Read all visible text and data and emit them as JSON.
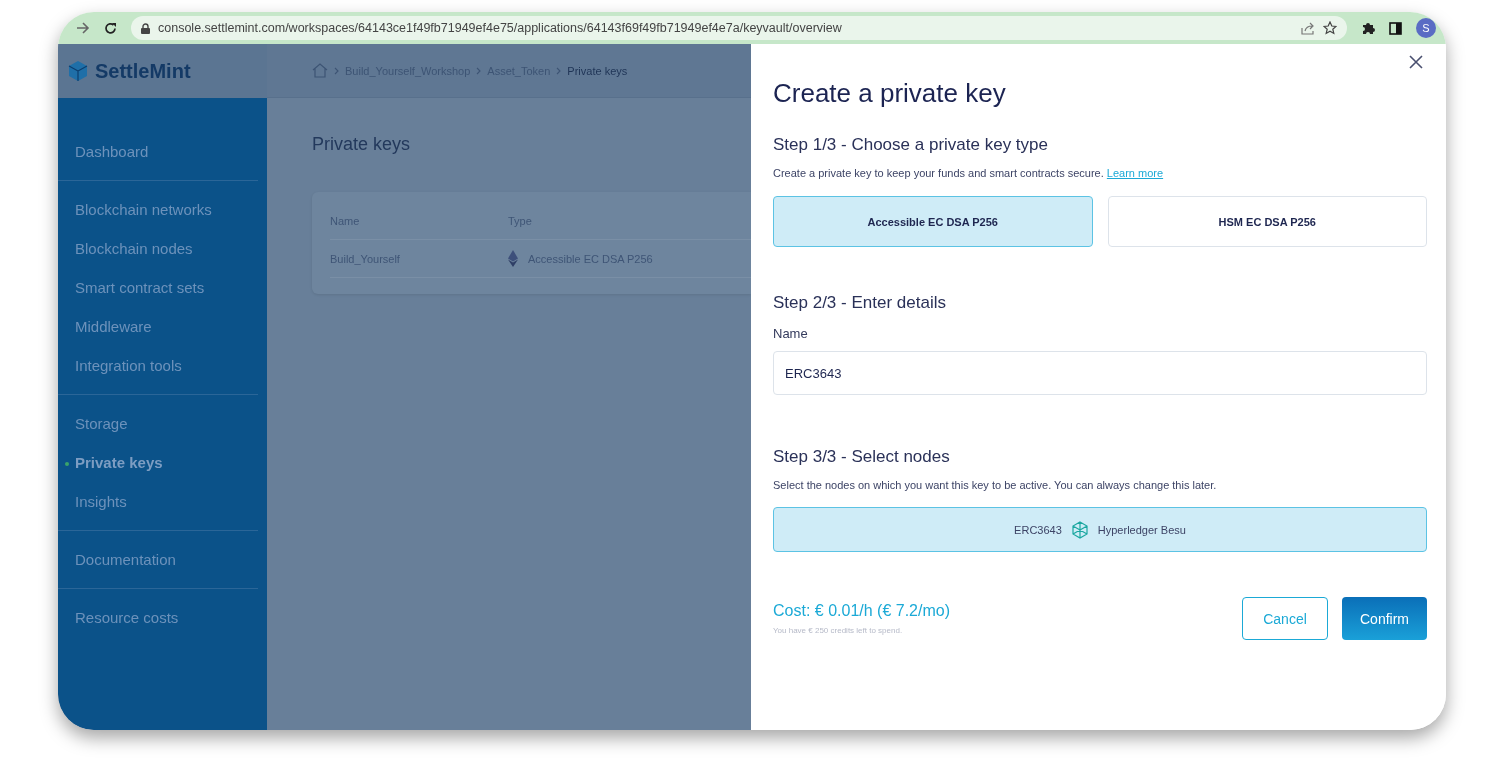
{
  "browser": {
    "url": "console.settlemint.com/workspaces/64143ce1f49fb71949ef4e75/applications/64143f69f49fb71949ef4e7a/keyvault/overview",
    "avatar": "S"
  },
  "app": {
    "logo": "SettleMint",
    "breadcrumbs": [
      "Build_Yourself_Workshop",
      "Asset_Token",
      "Private keys"
    ],
    "sidebar": {
      "groups": [
        {
          "items": [
            {
              "label": "Dashboard",
              "selected": false
            }
          ]
        },
        {
          "items": [
            {
              "label": "Blockchain networks",
              "selected": false
            },
            {
              "label": "Blockchain nodes",
              "selected": false
            },
            {
              "label": "Smart contract sets",
              "selected": false
            },
            {
              "label": "Middleware",
              "selected": false
            },
            {
              "label": "Integration tools",
              "selected": false
            }
          ]
        },
        {
          "items": [
            {
              "label": "Storage",
              "selected": false
            },
            {
              "label": "Private keys",
              "selected": true
            },
            {
              "label": "Insights",
              "selected": false
            }
          ]
        },
        {
          "items": [
            {
              "label": "Documentation",
              "selected": false
            }
          ]
        },
        {
          "items": [
            {
              "label": "Resource costs",
              "selected": false
            }
          ]
        }
      ]
    },
    "page_title": "Private keys",
    "table": {
      "columns": [
        "Name",
        "Type"
      ],
      "rows": [
        {
          "name": "Build_Yourself",
          "type": "Accessible EC DSA P256"
        }
      ]
    }
  },
  "modal": {
    "title": "Create a private key",
    "step1": {
      "heading": "Step 1/3 - Choose a private key type",
      "description": "Create a private key to keep your funds and smart contracts secure.",
      "link": "Learn more",
      "options": [
        {
          "label": "Accessible EC DSA P256",
          "selected": true
        },
        {
          "label": "HSM EC DSA P256",
          "selected": false
        }
      ]
    },
    "step2": {
      "heading": "Step 2/3 - Enter details",
      "field_label": "Name",
      "value": "ERC3643"
    },
    "step3": {
      "heading": "Step 3/3 - Select nodes",
      "description": "Select the nodes on which you want this key to be active. You can always change this later.",
      "nodes": [
        {
          "name": "ERC3643",
          "network": "Hyperledger Besu",
          "selected": true
        }
      ]
    },
    "cost": "Cost: € 0.01/h (€ 7.2/mo)",
    "credits": "You have € 250 credits left to spend.",
    "buttons": {
      "cancel": "Cancel",
      "confirm": "Confirm"
    }
  }
}
